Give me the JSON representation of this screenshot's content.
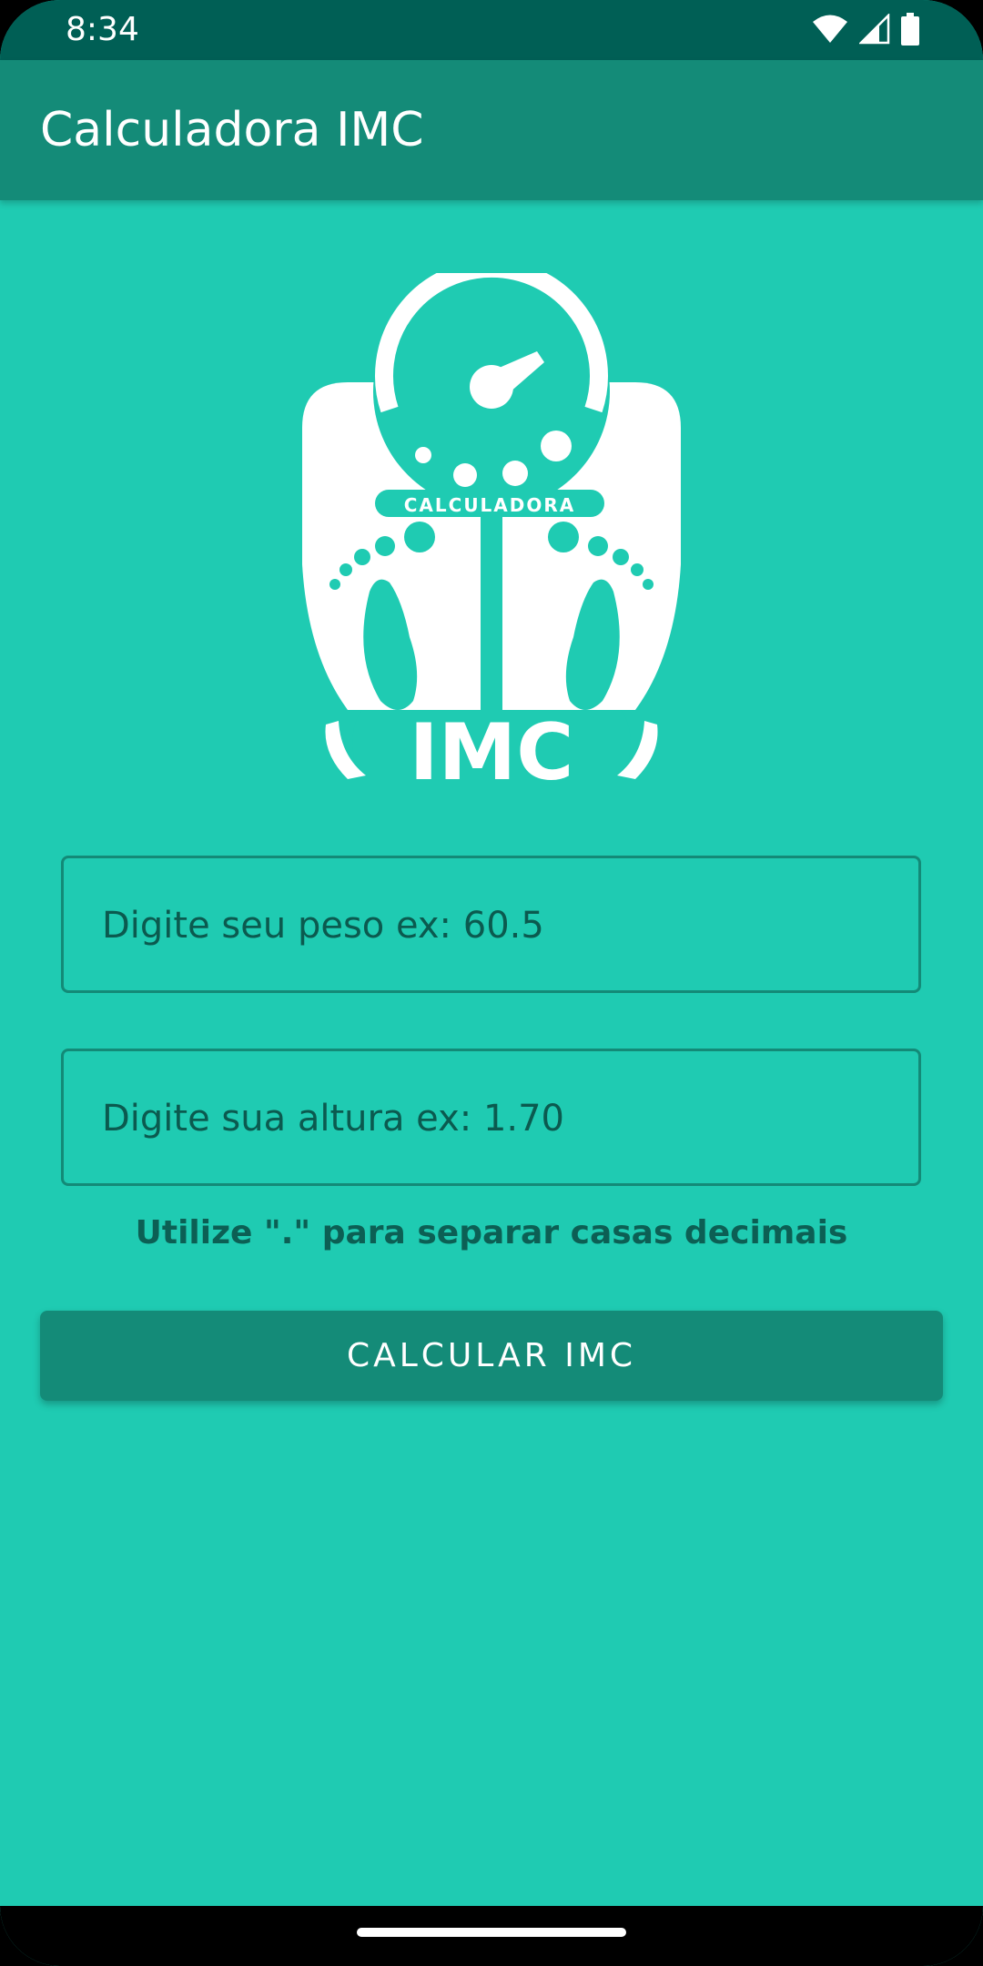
{
  "status_bar": {
    "time": "8:34",
    "icons": [
      "wifi-icon",
      "cell-signal-icon",
      "battery-icon"
    ]
  },
  "app_bar": {
    "title": "Calculadora IMC"
  },
  "logo": {
    "top_text": "CALCULADORA",
    "bottom_text": "IMC",
    "icon": "scale-icon"
  },
  "form": {
    "weight_placeholder": "Digite seu peso ex: 60.5",
    "height_placeholder": "Digite sua altura ex: 1.70",
    "hint": "Utilize \".\" para separar casas decimais",
    "button_label": "CALCULAR IMC"
  },
  "colors": {
    "background": "#1fcbb2",
    "app_bar": "#148b78",
    "status_bar": "#005f55",
    "accent_text": "#0c5f54"
  }
}
